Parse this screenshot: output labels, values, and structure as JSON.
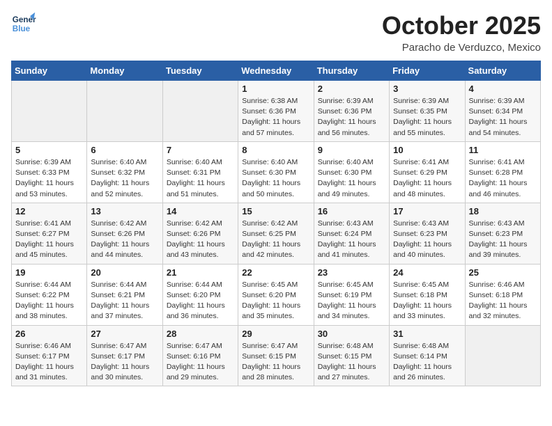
{
  "header": {
    "logo_line1": "General",
    "logo_line2": "Blue",
    "month": "October 2025",
    "location": "Paracho de Verduzco, Mexico"
  },
  "weekdays": [
    "Sunday",
    "Monday",
    "Tuesday",
    "Wednesday",
    "Thursday",
    "Friday",
    "Saturday"
  ],
  "weeks": [
    [
      {
        "day": "",
        "info": ""
      },
      {
        "day": "",
        "info": ""
      },
      {
        "day": "",
        "info": ""
      },
      {
        "day": "1",
        "info": "Sunrise: 6:38 AM\nSunset: 6:36 PM\nDaylight: 11 hours and 57 minutes."
      },
      {
        "day": "2",
        "info": "Sunrise: 6:39 AM\nSunset: 6:36 PM\nDaylight: 11 hours and 56 minutes."
      },
      {
        "day": "3",
        "info": "Sunrise: 6:39 AM\nSunset: 6:35 PM\nDaylight: 11 hours and 55 minutes."
      },
      {
        "day": "4",
        "info": "Sunrise: 6:39 AM\nSunset: 6:34 PM\nDaylight: 11 hours and 54 minutes."
      }
    ],
    [
      {
        "day": "5",
        "info": "Sunrise: 6:39 AM\nSunset: 6:33 PM\nDaylight: 11 hours and 53 minutes."
      },
      {
        "day": "6",
        "info": "Sunrise: 6:40 AM\nSunset: 6:32 PM\nDaylight: 11 hours and 52 minutes."
      },
      {
        "day": "7",
        "info": "Sunrise: 6:40 AM\nSunset: 6:31 PM\nDaylight: 11 hours and 51 minutes."
      },
      {
        "day": "8",
        "info": "Sunrise: 6:40 AM\nSunset: 6:30 PM\nDaylight: 11 hours and 50 minutes."
      },
      {
        "day": "9",
        "info": "Sunrise: 6:40 AM\nSunset: 6:30 PM\nDaylight: 11 hours and 49 minutes."
      },
      {
        "day": "10",
        "info": "Sunrise: 6:41 AM\nSunset: 6:29 PM\nDaylight: 11 hours and 48 minutes."
      },
      {
        "day": "11",
        "info": "Sunrise: 6:41 AM\nSunset: 6:28 PM\nDaylight: 11 hours and 46 minutes."
      }
    ],
    [
      {
        "day": "12",
        "info": "Sunrise: 6:41 AM\nSunset: 6:27 PM\nDaylight: 11 hours and 45 minutes."
      },
      {
        "day": "13",
        "info": "Sunrise: 6:42 AM\nSunset: 6:26 PM\nDaylight: 11 hours and 44 minutes."
      },
      {
        "day": "14",
        "info": "Sunrise: 6:42 AM\nSunset: 6:26 PM\nDaylight: 11 hours and 43 minutes."
      },
      {
        "day": "15",
        "info": "Sunrise: 6:42 AM\nSunset: 6:25 PM\nDaylight: 11 hours and 42 minutes."
      },
      {
        "day": "16",
        "info": "Sunrise: 6:43 AM\nSunset: 6:24 PM\nDaylight: 11 hours and 41 minutes."
      },
      {
        "day": "17",
        "info": "Sunrise: 6:43 AM\nSunset: 6:23 PM\nDaylight: 11 hours and 40 minutes."
      },
      {
        "day": "18",
        "info": "Sunrise: 6:43 AM\nSunset: 6:23 PM\nDaylight: 11 hours and 39 minutes."
      }
    ],
    [
      {
        "day": "19",
        "info": "Sunrise: 6:44 AM\nSunset: 6:22 PM\nDaylight: 11 hours and 38 minutes."
      },
      {
        "day": "20",
        "info": "Sunrise: 6:44 AM\nSunset: 6:21 PM\nDaylight: 11 hours and 37 minutes."
      },
      {
        "day": "21",
        "info": "Sunrise: 6:44 AM\nSunset: 6:20 PM\nDaylight: 11 hours and 36 minutes."
      },
      {
        "day": "22",
        "info": "Sunrise: 6:45 AM\nSunset: 6:20 PM\nDaylight: 11 hours and 35 minutes."
      },
      {
        "day": "23",
        "info": "Sunrise: 6:45 AM\nSunset: 6:19 PM\nDaylight: 11 hours and 34 minutes."
      },
      {
        "day": "24",
        "info": "Sunrise: 6:45 AM\nSunset: 6:18 PM\nDaylight: 11 hours and 33 minutes."
      },
      {
        "day": "25",
        "info": "Sunrise: 6:46 AM\nSunset: 6:18 PM\nDaylight: 11 hours and 32 minutes."
      }
    ],
    [
      {
        "day": "26",
        "info": "Sunrise: 6:46 AM\nSunset: 6:17 PM\nDaylight: 11 hours and 31 minutes."
      },
      {
        "day": "27",
        "info": "Sunrise: 6:47 AM\nSunset: 6:17 PM\nDaylight: 11 hours and 30 minutes."
      },
      {
        "day": "28",
        "info": "Sunrise: 6:47 AM\nSunset: 6:16 PM\nDaylight: 11 hours and 29 minutes."
      },
      {
        "day": "29",
        "info": "Sunrise: 6:47 AM\nSunset: 6:15 PM\nDaylight: 11 hours and 28 minutes."
      },
      {
        "day": "30",
        "info": "Sunrise: 6:48 AM\nSunset: 6:15 PM\nDaylight: 11 hours and 27 minutes."
      },
      {
        "day": "31",
        "info": "Sunrise: 6:48 AM\nSunset: 6:14 PM\nDaylight: 11 hours and 26 minutes."
      },
      {
        "day": "",
        "info": ""
      }
    ]
  ]
}
